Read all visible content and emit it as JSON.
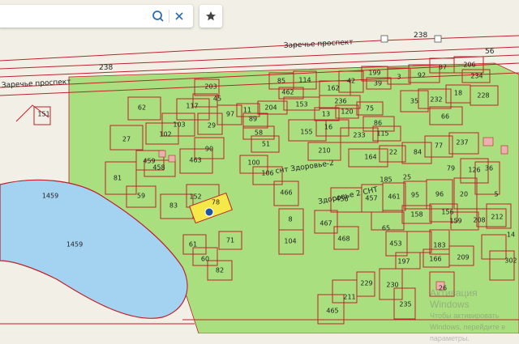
{
  "search": {
    "value": "",
    "placeholder": ""
  },
  "icons": {
    "search": "search-icon",
    "clear": "close-icon",
    "favorite": "star-icon",
    "bus_stop": "bus-stop-icon",
    "marker": "location-marker-icon"
  },
  "colors": {
    "land": "#f2efe6",
    "park": "#a9df7f",
    "water": "#a4d3f2",
    "plot_border": "#c0202a",
    "selected_plot": "#f5e94a",
    "marker": "#1d55a3",
    "building": "#e9b2ae"
  },
  "roads": {
    "prospect_north": "Заречье проспект",
    "prospect_west": "Заречье проспект",
    "snt_label": "снт Здоровье-2",
    "snt_label_2": "Здоровье 2 СНТ",
    "road_number_1": "238",
    "road_number_2": "238",
    "road_number_3": "56"
  },
  "water": {
    "lake_north": "1459",
    "lake_center": "1459"
  },
  "plots": {
    "p1": "151",
    "p2": "203",
    "p3": "45",
    "p4": "117",
    "p5": "62",
    "p6": "97",
    "p7": "11",
    "p8": "204",
    "p9": "153",
    "p10": "236",
    "p11": "13",
    "p12": "120",
    "p13": "75",
    "p14": "85",
    "p15": "114",
    "p16": "462",
    "p17": "162",
    "p18": "42",
    "p19": "199",
    "p20": "3",
    "p21": "92",
    "p22": "87",
    "p23": "206",
    "p24": "39",
    "p25": "234",
    "p26": "228",
    "p27": "232",
    "p28": "35",
    "p29": "18",
    "p30": "66",
    "p31": "29",
    "p32": "103",
    "p33": "102",
    "p34": "27",
    "p35": "89",
    "p36": "58",
    "p37": "155",
    "p38": "16",
    "p39": "86",
    "p40": "233",
    "p41": "115",
    "p42": "459",
    "p43": "458",
    "p44": "90",
    "p45": "463",
    "p46": "210",
    "p47": "51",
    "p48": "164",
    "p49": "22",
    "p50": "84",
    "p51": "77",
    "p52": "237",
    "p53": "81",
    "p54": "100",
    "p55": "106",
    "p56": "466",
    "p57": "59",
    "p58": "152",
    "p59": "78",
    "p60": "83",
    "p61": "61",
    "p62": "60",
    "p63": "71",
    "p64": "82",
    "p65": "104",
    "p66": "8",
    "p67": "467",
    "p68": "468",
    "p69": "456",
    "p70": "457",
    "p71": "461",
    "p72": "185",
    "p73": "25",
    "p74": "95",
    "p75": "96",
    "p76": "20",
    "p77": "126",
    "p78": "65",
    "p79": "158",
    "p80": "156",
    "p81": "159",
    "p82": "208",
    "p83": "212",
    "p84": "453",
    "p85": "183",
    "p86": "197",
    "p87": "166",
    "p88": "209",
    "p89": "465",
    "p90": "211",
    "p91": "230",
    "p92": "229",
    "p93": "235",
    "p94": "26",
    "p95": "302",
    "p96": "36",
    "p97": "79",
    "p98": "5",
    "p99": "14"
  },
  "watermark": {
    "line1": "Активация Windows",
    "line2": "Чтобы активировать Windows, перейдите в параметры."
  }
}
